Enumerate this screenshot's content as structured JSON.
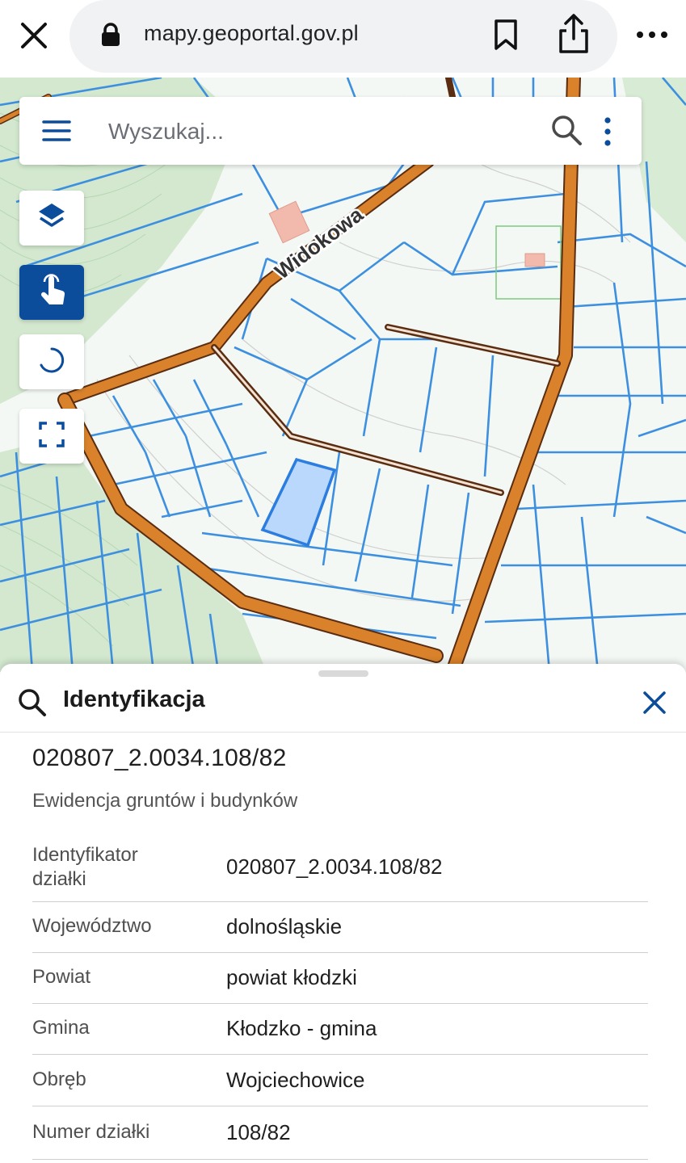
{
  "browser": {
    "url": "mapy.geoportal.gov.pl"
  },
  "map": {
    "search_placeholder": "Wyszukaj...",
    "street_label": "Widokowa",
    "colors": {
      "road": "#d9822b",
      "parcel_border": "#3d8fdf",
      "selected_parcel_fill": "#b9d8fb",
      "forest": "#cfe6cc",
      "active_tool": "#0b4d9b"
    },
    "tools": [
      "layers-icon",
      "touch-identify-icon",
      "loading-spinner-icon",
      "fullscreen-icon"
    ]
  },
  "panel": {
    "title": "Identyfikacja",
    "parcel_id": "020807_2.0034.108/82",
    "subtitle": "Ewidencja gruntów i budynków",
    "rows": [
      {
        "key": "Identyfikator działki",
        "value": "020807_2.0034.108/82"
      },
      {
        "key": "Województwo",
        "value": "dolnośląskie"
      },
      {
        "key": "Powiat",
        "value": "powiat kłodzki"
      },
      {
        "key": "Gmina",
        "value": "Kłodzko - gmina"
      },
      {
        "key": "Obręb",
        "value": "Wojciechowice"
      },
      {
        "key": "Numer działki",
        "value": "108/82"
      }
    ]
  }
}
